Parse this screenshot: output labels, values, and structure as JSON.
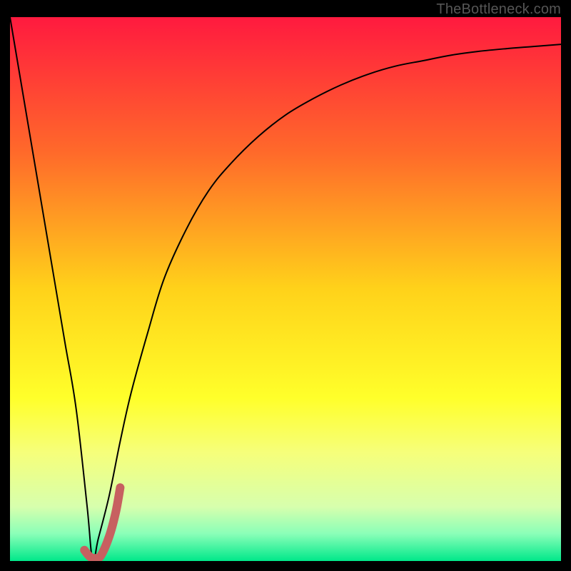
{
  "watermark": "TheBottleneck.com",
  "chart_data": {
    "type": "line",
    "title": "",
    "xlabel": "",
    "ylabel": "",
    "xlim": [
      0,
      100
    ],
    "ylim": [
      0,
      100
    ],
    "gradient_stops": [
      {
        "offset": 0.0,
        "color": "#ff1a3f"
      },
      {
        "offset": 0.25,
        "color": "#ff6a2a"
      },
      {
        "offset": 0.5,
        "color": "#ffd21a"
      },
      {
        "offset": 0.7,
        "color": "#ffff2a"
      },
      {
        "offset": 0.8,
        "color": "#f6ff7a"
      },
      {
        "offset": 0.9,
        "color": "#d7ffad"
      },
      {
        "offset": 0.95,
        "color": "#8affb8"
      },
      {
        "offset": 1.0,
        "color": "#00e88a"
      }
    ],
    "series": [
      {
        "name": "bottleneck-curve",
        "color": "#000000",
        "width": 2,
        "x": [
          0,
          2,
          4,
          6,
          8,
          10,
          12,
          14,
          15,
          16,
          18,
          20,
          22,
          25,
          28,
          32,
          36,
          40,
          45,
          50,
          55,
          60,
          65,
          70,
          75,
          80,
          85,
          90,
          95,
          100
        ],
        "y": [
          100,
          88,
          76,
          64,
          52,
          40,
          28,
          10,
          0,
          4,
          12,
          22,
          31,
          42,
          52,
          61,
          68,
          73,
          78,
          82,
          85,
          87.5,
          89.5,
          91,
          92,
          93,
          93.7,
          94.2,
          94.6,
          95
        ]
      },
      {
        "name": "highlight-j",
        "color": "#c76060",
        "width": 12,
        "cap": "round",
        "x": [
          13.5,
          14.5,
          15.5,
          16.5,
          18.0,
          19.2,
          20.0
        ],
        "y": [
          2.0,
          0.8,
          0.5,
          1.0,
          4.5,
          9.0,
          13.5
        ]
      }
    ]
  }
}
